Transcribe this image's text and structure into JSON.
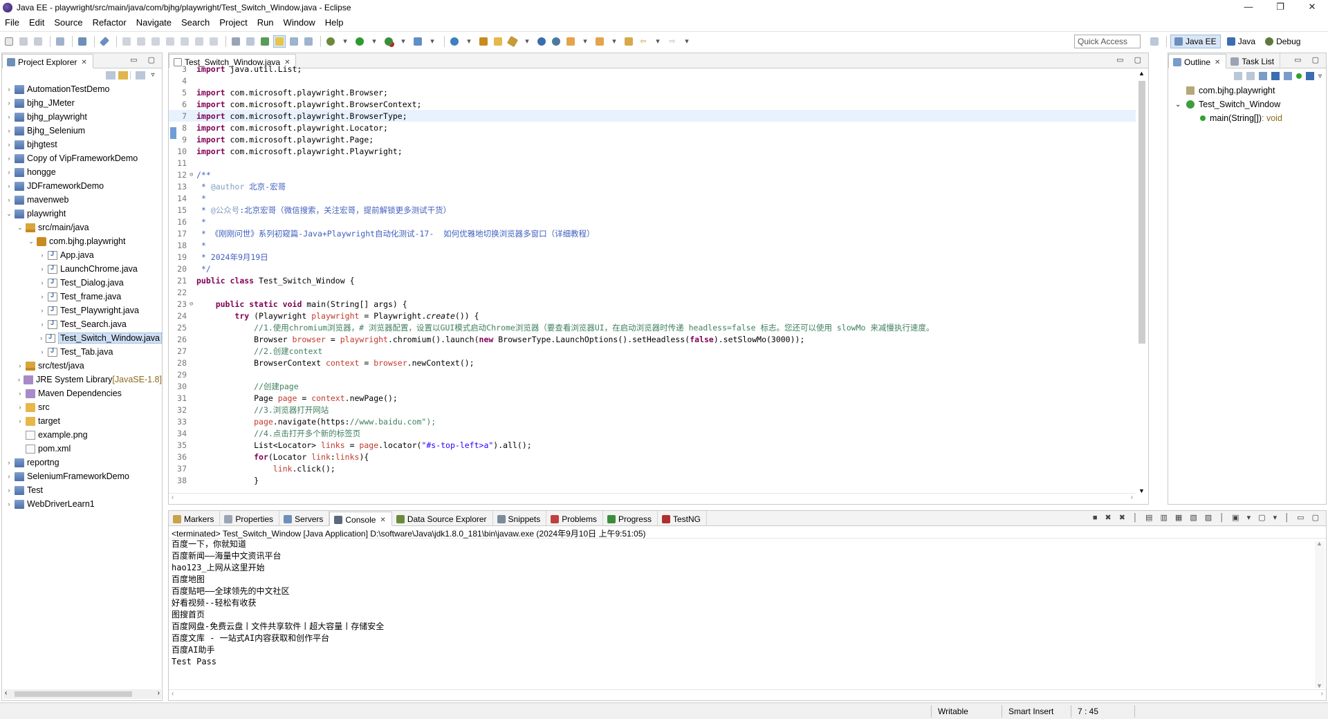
{
  "window": {
    "title": "Java EE - playwright/src/main/java/com/bjhg/playwright/Test_Switch_Window.java - Eclipse",
    "min": "—",
    "max": "❐",
    "close": "✕"
  },
  "menu": [
    "File",
    "Edit",
    "Source",
    "Refactor",
    "Navigate",
    "Search",
    "Project",
    "Run",
    "Window",
    "Help"
  ],
  "toolbar": {
    "quick_access": "Quick Access",
    "perspectives": [
      "Java EE",
      "Java",
      "Debug"
    ]
  },
  "explorer": {
    "tab": "Project Explorer",
    "items": [
      {
        "label": "AutomationTestDemo",
        "icon": "project",
        "level": 0,
        "arrow": "›"
      },
      {
        "label": "bjhg_JMeter",
        "icon": "project",
        "level": 0,
        "arrow": "›"
      },
      {
        "label": "bjhg_playwright",
        "icon": "project",
        "level": 0,
        "arrow": "›"
      },
      {
        "label": "Bjhg_Selenium",
        "icon": "project",
        "level": 0,
        "arrow": "›"
      },
      {
        "label": "bjhgtest",
        "icon": "project",
        "level": 0,
        "arrow": "›"
      },
      {
        "label": "Copy of VipFrameworkDemo",
        "icon": "project",
        "level": 0,
        "arrow": "›"
      },
      {
        "label": "hongge",
        "icon": "project",
        "level": 0,
        "arrow": "›"
      },
      {
        "label": "JDFrameworkDemo",
        "icon": "project",
        "level": 0,
        "arrow": "›"
      },
      {
        "label": "mavenweb",
        "icon": "project",
        "level": 0,
        "arrow": "›"
      },
      {
        "label": "playwright",
        "icon": "project",
        "level": 0,
        "arrow": "⌄"
      },
      {
        "label": "src/main/java",
        "icon": "srcfolder",
        "level": 1,
        "arrow": "⌄"
      },
      {
        "label": "com.bjhg.playwright",
        "icon": "package",
        "level": 2,
        "arrow": "⌄"
      },
      {
        "label": "App.java",
        "icon": "java",
        "level": 3,
        "arrow": "›"
      },
      {
        "label": "LaunchChrome.java",
        "icon": "java",
        "level": 3,
        "arrow": "›"
      },
      {
        "label": "Test_Dialog.java",
        "icon": "java",
        "level": 3,
        "arrow": "›"
      },
      {
        "label": "Test_frame.java",
        "icon": "java",
        "level": 3,
        "arrow": "›"
      },
      {
        "label": "Test_Playwright.java",
        "icon": "java",
        "level": 3,
        "arrow": "›"
      },
      {
        "label": "Test_Search.java",
        "icon": "java",
        "level": 3,
        "arrow": "›"
      },
      {
        "label": "Test_Switch_Window.java",
        "icon": "java",
        "level": 3,
        "arrow": "›",
        "selected": true
      },
      {
        "label": "Test_Tab.java",
        "icon": "java",
        "level": 3,
        "arrow": "›"
      },
      {
        "label": "src/test/java",
        "icon": "srcfolder",
        "level": 1,
        "arrow": "›"
      },
      {
        "label": "JRE System Library",
        "suffix": " [JavaSE-1.8]",
        "icon": "lib",
        "level": 1,
        "arrow": "›"
      },
      {
        "label": "Maven Dependencies",
        "icon": "lib",
        "level": 1,
        "arrow": "›"
      },
      {
        "label": "src",
        "icon": "folder",
        "level": 1,
        "arrow": "›"
      },
      {
        "label": "target",
        "icon": "folder",
        "level": 1,
        "arrow": "›"
      },
      {
        "label": "example.png",
        "icon": "file",
        "level": 1,
        "arrow": ""
      },
      {
        "label": "pom.xml",
        "icon": "file",
        "level": 1,
        "arrow": ""
      },
      {
        "label": "reportng",
        "icon": "project",
        "level": 0,
        "arrow": "›"
      },
      {
        "label": "SeleniumFrameworkDemo",
        "icon": "project",
        "level": 0,
        "arrow": "›"
      },
      {
        "label": "Test",
        "icon": "project",
        "level": 0,
        "arrow": "›"
      },
      {
        "label": "WebDriverLearn1",
        "icon": "project",
        "level": 0,
        "arrow": "›"
      }
    ]
  },
  "editor": {
    "tab": "Test_Switch_Window.java",
    "current_line": 7,
    "lines": [
      {
        "n": "3",
        "fold": "",
        "t": "import java.util.List;"
      },
      {
        "n": "4",
        "fold": "",
        "t": ""
      },
      {
        "n": "5",
        "fold": "",
        "t": "import com.microsoft.playwright.Browser;"
      },
      {
        "n": "6",
        "fold": "",
        "t": "import com.microsoft.playwright.BrowserContext;"
      },
      {
        "n": "7",
        "fold": "",
        "t": "import com.microsoft.playwright.BrowserType;"
      },
      {
        "n": "8",
        "fold": "",
        "t": "import com.microsoft.playwright.Locator;"
      },
      {
        "n": "9",
        "fold": "",
        "t": "import com.microsoft.playwright.Page;"
      },
      {
        "n": "10",
        "fold": "",
        "t": "import com.microsoft.playwright.Playwright;"
      },
      {
        "n": "11",
        "fold": "",
        "t": ""
      },
      {
        "n": "12",
        "fold": "⊖",
        "t": "/**"
      },
      {
        "n": "13",
        "fold": "",
        "t": " * @author 北京-宏哥"
      },
      {
        "n": "14",
        "fold": "",
        "t": " *"
      },
      {
        "n": "15",
        "fold": "",
        "t": " * @公众号:北京宏哥（微信搜索，关注宏哥，提前解锁更多测试干货）"
      },
      {
        "n": "16",
        "fold": "",
        "t": " *"
      },
      {
        "n": "17",
        "fold": "",
        "t": " * 《刚刚问世》系列初窥篇-Java+Playwright自动化测试-17-  如何优雅地切换浏览器多窗口（详细教程）"
      },
      {
        "n": "18",
        "fold": "",
        "t": " *"
      },
      {
        "n": "19",
        "fold": "",
        "t": " * 2024年9月19日"
      },
      {
        "n": "20",
        "fold": "",
        "t": " */"
      },
      {
        "n": "21",
        "fold": "",
        "t": "public class Test_Switch_Window {"
      },
      {
        "n": "22",
        "fold": "",
        "t": ""
      },
      {
        "n": "23",
        "fold": "⊖",
        "t": "    public static void main(String[] args) {"
      },
      {
        "n": "24",
        "fold": "",
        "t": "        try (Playwright playwright = Playwright.create()) {"
      },
      {
        "n": "25",
        "fold": "",
        "t": "            //1.使用chromium浏览器，# 浏览器配置，设置以GUI模式启动Chrome浏览器（要查看浏览器UI，在启动浏览器时传递 headless=false 标志。您还可以使用 slowMo 来减慢执行速度。"
      },
      {
        "n": "26",
        "fold": "",
        "t": "            Browser browser = playwright.chromium().launch(new BrowserType.LaunchOptions().setHeadless(false).setSlowMo(3000));"
      },
      {
        "n": "27",
        "fold": "",
        "t": "            //2.创建context"
      },
      {
        "n": "28",
        "fold": "",
        "t": "            BrowserContext context = browser.newContext();"
      },
      {
        "n": "29",
        "fold": "",
        "t": ""
      },
      {
        "n": "30",
        "fold": "",
        "t": "            //创建page"
      },
      {
        "n": "31",
        "fold": "",
        "t": "            Page page = context.newPage();"
      },
      {
        "n": "32",
        "fold": "",
        "t": "            //3.浏览器打开网站"
      },
      {
        "n": "33",
        "fold": "",
        "t": "            page.navigate(\"https://www.baidu.com\");"
      },
      {
        "n": "34",
        "fold": "",
        "t": "            //4.点击打开多个新的标签页"
      },
      {
        "n": "35",
        "fold": "",
        "t": "            List<Locator> links = page.locator(\"#s-top-left>a\").all();"
      },
      {
        "n": "36",
        "fold": "",
        "t": "            for(Locator link:links){"
      },
      {
        "n": "37",
        "fold": "",
        "t": "                link.click();"
      },
      {
        "n": "38",
        "fold": "",
        "t": "            }"
      }
    ]
  },
  "outline": {
    "tabs": [
      "Outline",
      "Task List"
    ],
    "items": [
      {
        "label": "com.bjhg.playwright",
        "icon": "import",
        "level": 0,
        "arrow": ""
      },
      {
        "label": "Test_Switch_Window",
        "icon": "class",
        "level": 0,
        "arrow": "⌄"
      },
      {
        "label": "main(String[])",
        "ret": " : void",
        "icon": "method",
        "level": 1,
        "arrow": ""
      }
    ]
  },
  "console": {
    "tabs": [
      "Markers",
      "Properties",
      "Servers",
      "Console",
      "Data Source Explorer",
      "Snippets",
      "Problems",
      "Progress",
      "TestNG"
    ],
    "active_tab": "Console",
    "terminated": "<terminated> Test_Switch_Window [Java Application] D:\\software\\Java\\jdk1.8.0_181\\bin\\javaw.exe (2024年9月10日 上午9:51:05)",
    "lines": [
      "百度一下，你就知道",
      "百度新闻——海量中文资讯平台",
      "hao123_上网从这里开始",
      "百度地图",
      "百度贴吧——全球领先的中文社区",
      "好看视频--轻松有收获",
      "图搜首页",
      "百度网盘-免费云盘丨文件共享软件丨超大容量丨存储安全",
      "百度文库 - 一站式AI内容获取和创作平台",
      "百度AI助手",
      "Test Pass"
    ]
  },
  "status": {
    "writable": "Writable",
    "insert": "Smart Insert",
    "position": "7 : 45"
  }
}
